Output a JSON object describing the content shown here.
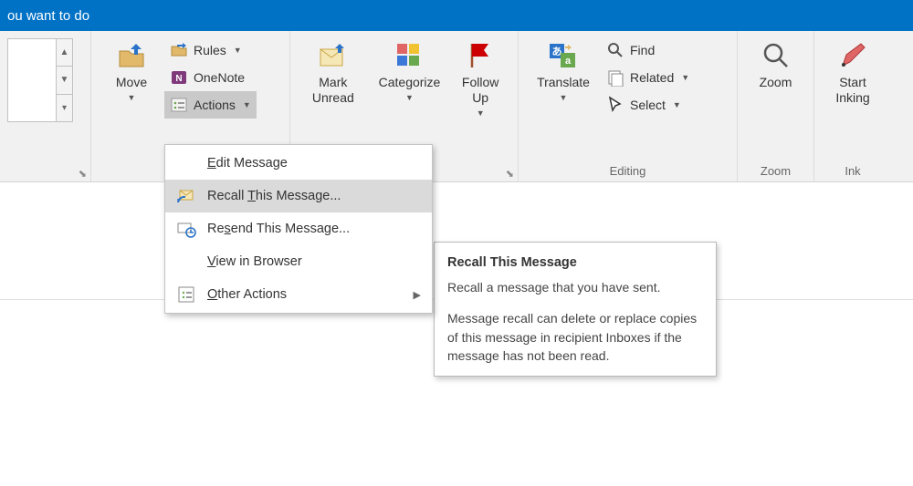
{
  "titlebar": {
    "text": "ou want to do"
  },
  "ribbon": {
    "move_group": {
      "move": "Move",
      "rules": "Rules",
      "onenote": "OneNote",
      "actions": "Actions"
    },
    "tags_group": {
      "label": "",
      "mark_unread": "Mark Unread",
      "categorize": "Categorize",
      "follow_up": "Follow Up"
    },
    "editing_group": {
      "label": "Editing",
      "translate": "Translate",
      "find": "Find",
      "related": "Related",
      "select": "Select"
    },
    "zoom_group": {
      "label": "Zoom",
      "zoom": "Zoom"
    },
    "ink_group": {
      "label": "Ink",
      "start_inking": "Start Inking"
    }
  },
  "actions_menu": {
    "edit": "dit Message",
    "edit_u": "E",
    "recall": "Recall ",
    "recall_u": "T",
    "recall_rest": "his Message...",
    "resend": "Re",
    "resend_u": "s",
    "resend_rest": "end This Message...",
    "view": "iew in Browser",
    "view_u": "V",
    "other": "ther Actions",
    "other_u": "O"
  },
  "tooltip": {
    "title": "Recall This Message",
    "p1": "Recall a message that you have sent.",
    "p2": "Message recall can delete or replace copies of this message in recipient Inboxes if the message has not been read."
  }
}
